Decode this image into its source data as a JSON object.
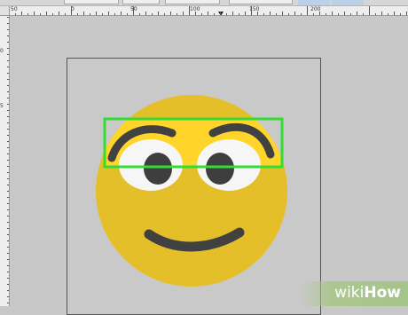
{
  "ruler": {
    "top_labels": [
      "50",
      "0",
      "50",
      "100",
      "150",
      "200"
    ],
    "left_labels": [
      "0",
      "5"
    ]
  },
  "canvas": {
    "image": "smiley-face-emoji",
    "selection_color": "#33dd33",
    "face_color": "#e5bf2a",
    "highlight_color": "#ffd52b",
    "feature_color": "#404040"
  },
  "watermark": {
    "wiki": "wiki",
    "how": "How"
  }
}
